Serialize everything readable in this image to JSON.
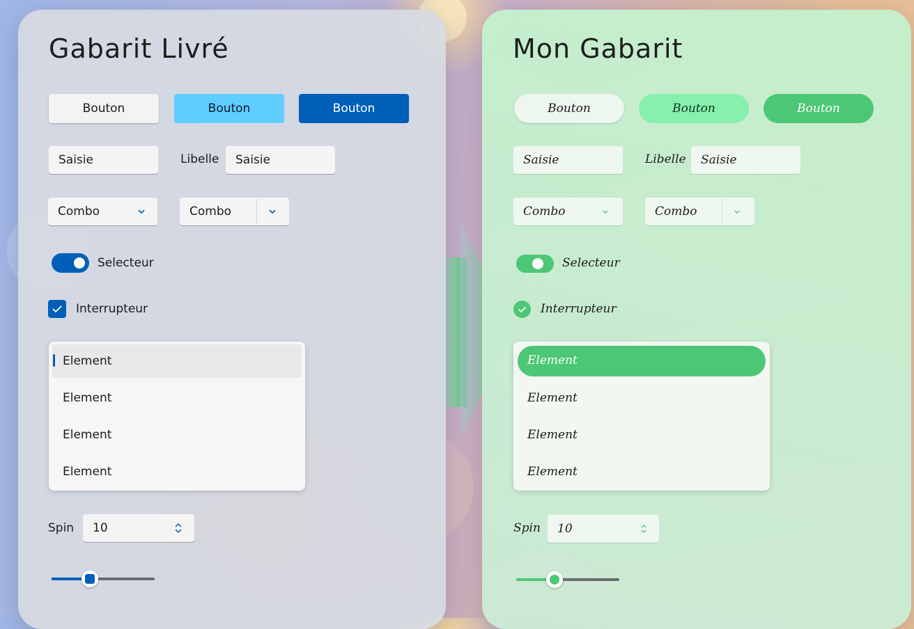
{
  "left": {
    "title": "Gabarit Livré",
    "buttons": [
      "Bouton",
      "Bouton",
      "Bouton"
    ],
    "input_value": "Saisie",
    "labeled_input": {
      "label": "Libelle",
      "value": "Saisie"
    },
    "combo1": "Combo",
    "combo2": "Combo",
    "toggle": {
      "label": "Selecteur",
      "on": true
    },
    "checkbox": {
      "label": "Interrupteur",
      "checked": true
    },
    "list_items": [
      "Element",
      "Element",
      "Element",
      "Element"
    ],
    "selected_item": 0,
    "spin": {
      "label": "Spin",
      "value": "10"
    },
    "slider_value": 0.37,
    "colors": {
      "accent": "#005fb8",
      "accent_light": "#60cdff",
      "panel": "#d6dae2"
    }
  },
  "right": {
    "title": "Mon Gabarit",
    "buttons": [
      "Bouton",
      "Bouton",
      "Bouton"
    ],
    "input_value": "Saisie",
    "labeled_input": {
      "label": "Libelle",
      "value": "Saisie"
    },
    "combo1": "Combo",
    "combo2": "Combo",
    "toggle": {
      "label": "Selecteur",
      "on": true
    },
    "checkbox": {
      "label": "Interrupteur",
      "checked": true
    },
    "list_items": [
      "Element",
      "Element",
      "Element",
      "Element"
    ],
    "selected_item": 0,
    "spin": {
      "label": "Spin",
      "value": "10"
    },
    "slider_value": 0.37,
    "colors": {
      "accent": "#4cc776",
      "accent_light": "#86f0ac",
      "panel": "#c8eed2"
    }
  },
  "icons": {
    "arrow": "chevron-right-arrow-icon",
    "combo": "chevron-down-icon",
    "spin": "up-down-chevron-icon",
    "check": "check-icon"
  }
}
